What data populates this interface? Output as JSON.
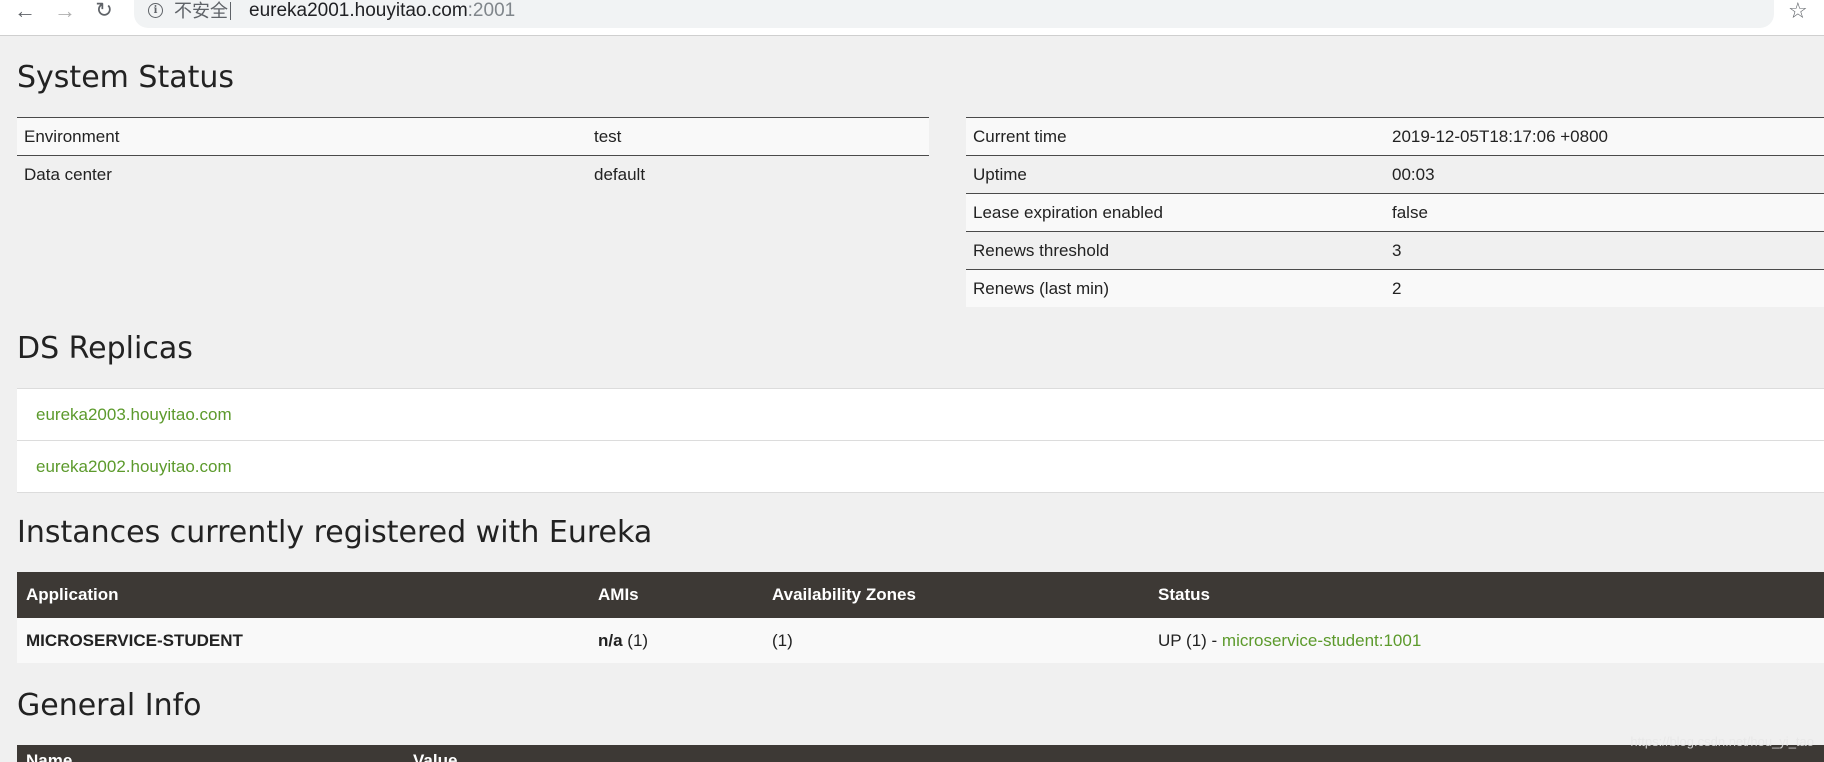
{
  "browser": {
    "security_label": "不安全",
    "url_host": "eureka2001.houyitao.com",
    "url_port": ":2001"
  },
  "system_status": {
    "title": "System Status",
    "left": [
      {
        "label": "Environment",
        "value": "test"
      },
      {
        "label": "Data center",
        "value": "default"
      }
    ],
    "right": [
      {
        "label": "Current time",
        "value": "2019-12-05T18:17:06 +0800"
      },
      {
        "label": "Uptime",
        "value": "00:03"
      },
      {
        "label": "Lease expiration enabled",
        "value": "false"
      },
      {
        "label": "Renews threshold",
        "value": "3"
      },
      {
        "label": "Renews (last min)",
        "value": "2"
      }
    ]
  },
  "ds_replicas": {
    "title": "DS Replicas",
    "items": [
      "eureka2003.houyitao.com",
      "eureka2002.houyitao.com"
    ]
  },
  "instances": {
    "title": "Instances currently registered with Eureka",
    "headers": [
      "Application",
      "AMIs",
      "Availability Zones",
      "Status"
    ],
    "rows": [
      {
        "application": "MICROSERVICE-STUDENT",
        "amis_bold": "n/a",
        "amis_count": " (1)",
        "zones": "(1)",
        "status_prefix": "UP (1) - ",
        "status_link": "microservice-student:1001"
      }
    ]
  },
  "general_info": {
    "title": "General Info",
    "headers": [
      "Name",
      "Value"
    ]
  },
  "watermark": "https://blog.csdn.net/hou_yi_tao"
}
